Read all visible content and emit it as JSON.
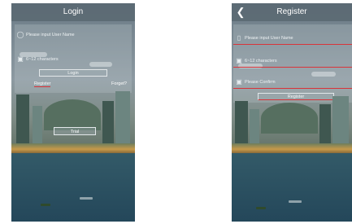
{
  "login": {
    "title": "Login",
    "username_placeholder": "Please input User Name",
    "password_placeholder": "6~12 characters",
    "login_button": "Login",
    "register_link": "Register",
    "forget_link": "Forget?",
    "trial_button": "Trial"
  },
  "register": {
    "title": "Register",
    "phone_placeholder": "Please input User Name",
    "password_placeholder": "6~12 characters",
    "confirm_placeholder": "Please Confirm",
    "register_button": "Register"
  },
  "colors": {
    "accent_underline": "#d9343a",
    "titlebar": "#5c6a74"
  },
  "icons": {
    "back": "chevron-left-icon",
    "user": "user-icon",
    "lock": "lock-icon",
    "phone": "phone-icon"
  }
}
